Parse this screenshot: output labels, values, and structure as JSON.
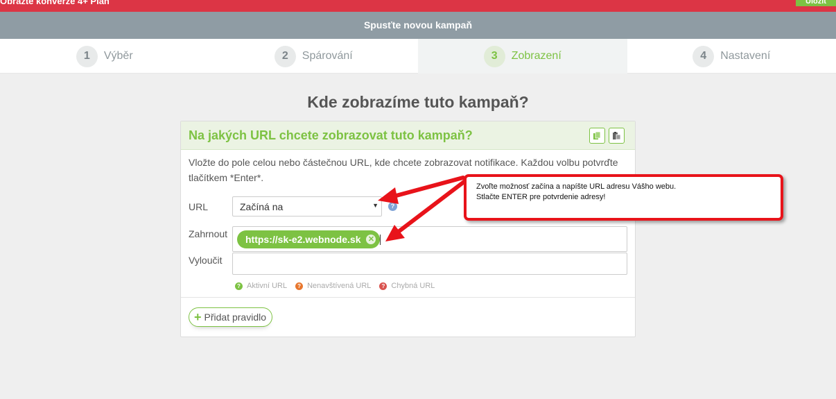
{
  "topbar": {
    "text": "Obrazte konverze 4+ Plan",
    "button_label": "Uložit"
  },
  "wizard": {
    "title": "Spusťte novou kampaň",
    "steps": [
      {
        "number": "1",
        "label": "Výběr",
        "active": false
      },
      {
        "number": "2",
        "label": "Spárování",
        "active": false
      },
      {
        "number": "3",
        "label": "Zobrazení",
        "active": true
      },
      {
        "number": "4",
        "label": "Nastavení",
        "active": false
      }
    ]
  },
  "main": {
    "title": "Kde zobrazíme tuto kampaň?"
  },
  "card": {
    "title": "Na jakých URL chcete zobrazovat tuto kampaň?",
    "description": "Vložte do pole celou nebo částečnou URL, kde chcete zobrazovat notifikace. Každou volbu potvrďte tlačítkem *Enter*.",
    "url_label": "URL",
    "url_select_value": "Začíná na",
    "include_label": "Zahrnout",
    "include_tags": [
      "https://sk-e2.webnode.sk"
    ],
    "exclude_label": "Vyloučit",
    "exclude_value": "",
    "legend": [
      {
        "label": "Aktivní URL",
        "color": "#7dc243"
      },
      {
        "label": "Nenavštívená URL",
        "color": "#e8772e"
      },
      {
        "label": "Chybná URL",
        "color": "#d9534f"
      }
    ],
    "add_rule_label": "Přidat pravidlo"
  },
  "callout": {
    "line1": "Zvoľte možnosť začína a napíšte URL adresu Vášho webu.",
    "line2": "Stlačte ENTER pre potvrdenie adresy!",
    "border_color": "#e8131a"
  },
  "colors": {
    "accent": "#7dc243",
    "topbar": "#dc3545",
    "header": "#8f9ca4"
  }
}
